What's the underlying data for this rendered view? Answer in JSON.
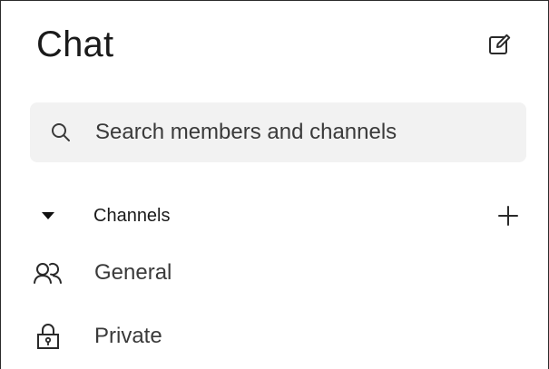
{
  "header": {
    "title": "Chat",
    "compose_icon": "compose-icon"
  },
  "search": {
    "placeholder": "Search members and channels",
    "icon": "search-icon"
  },
  "sections": {
    "channels": {
      "label": "Channels",
      "expanded": true,
      "items": [
        {
          "label": "General",
          "icon": "group-icon"
        },
        {
          "label": "Private",
          "icon": "lock-icon"
        }
      ]
    }
  }
}
